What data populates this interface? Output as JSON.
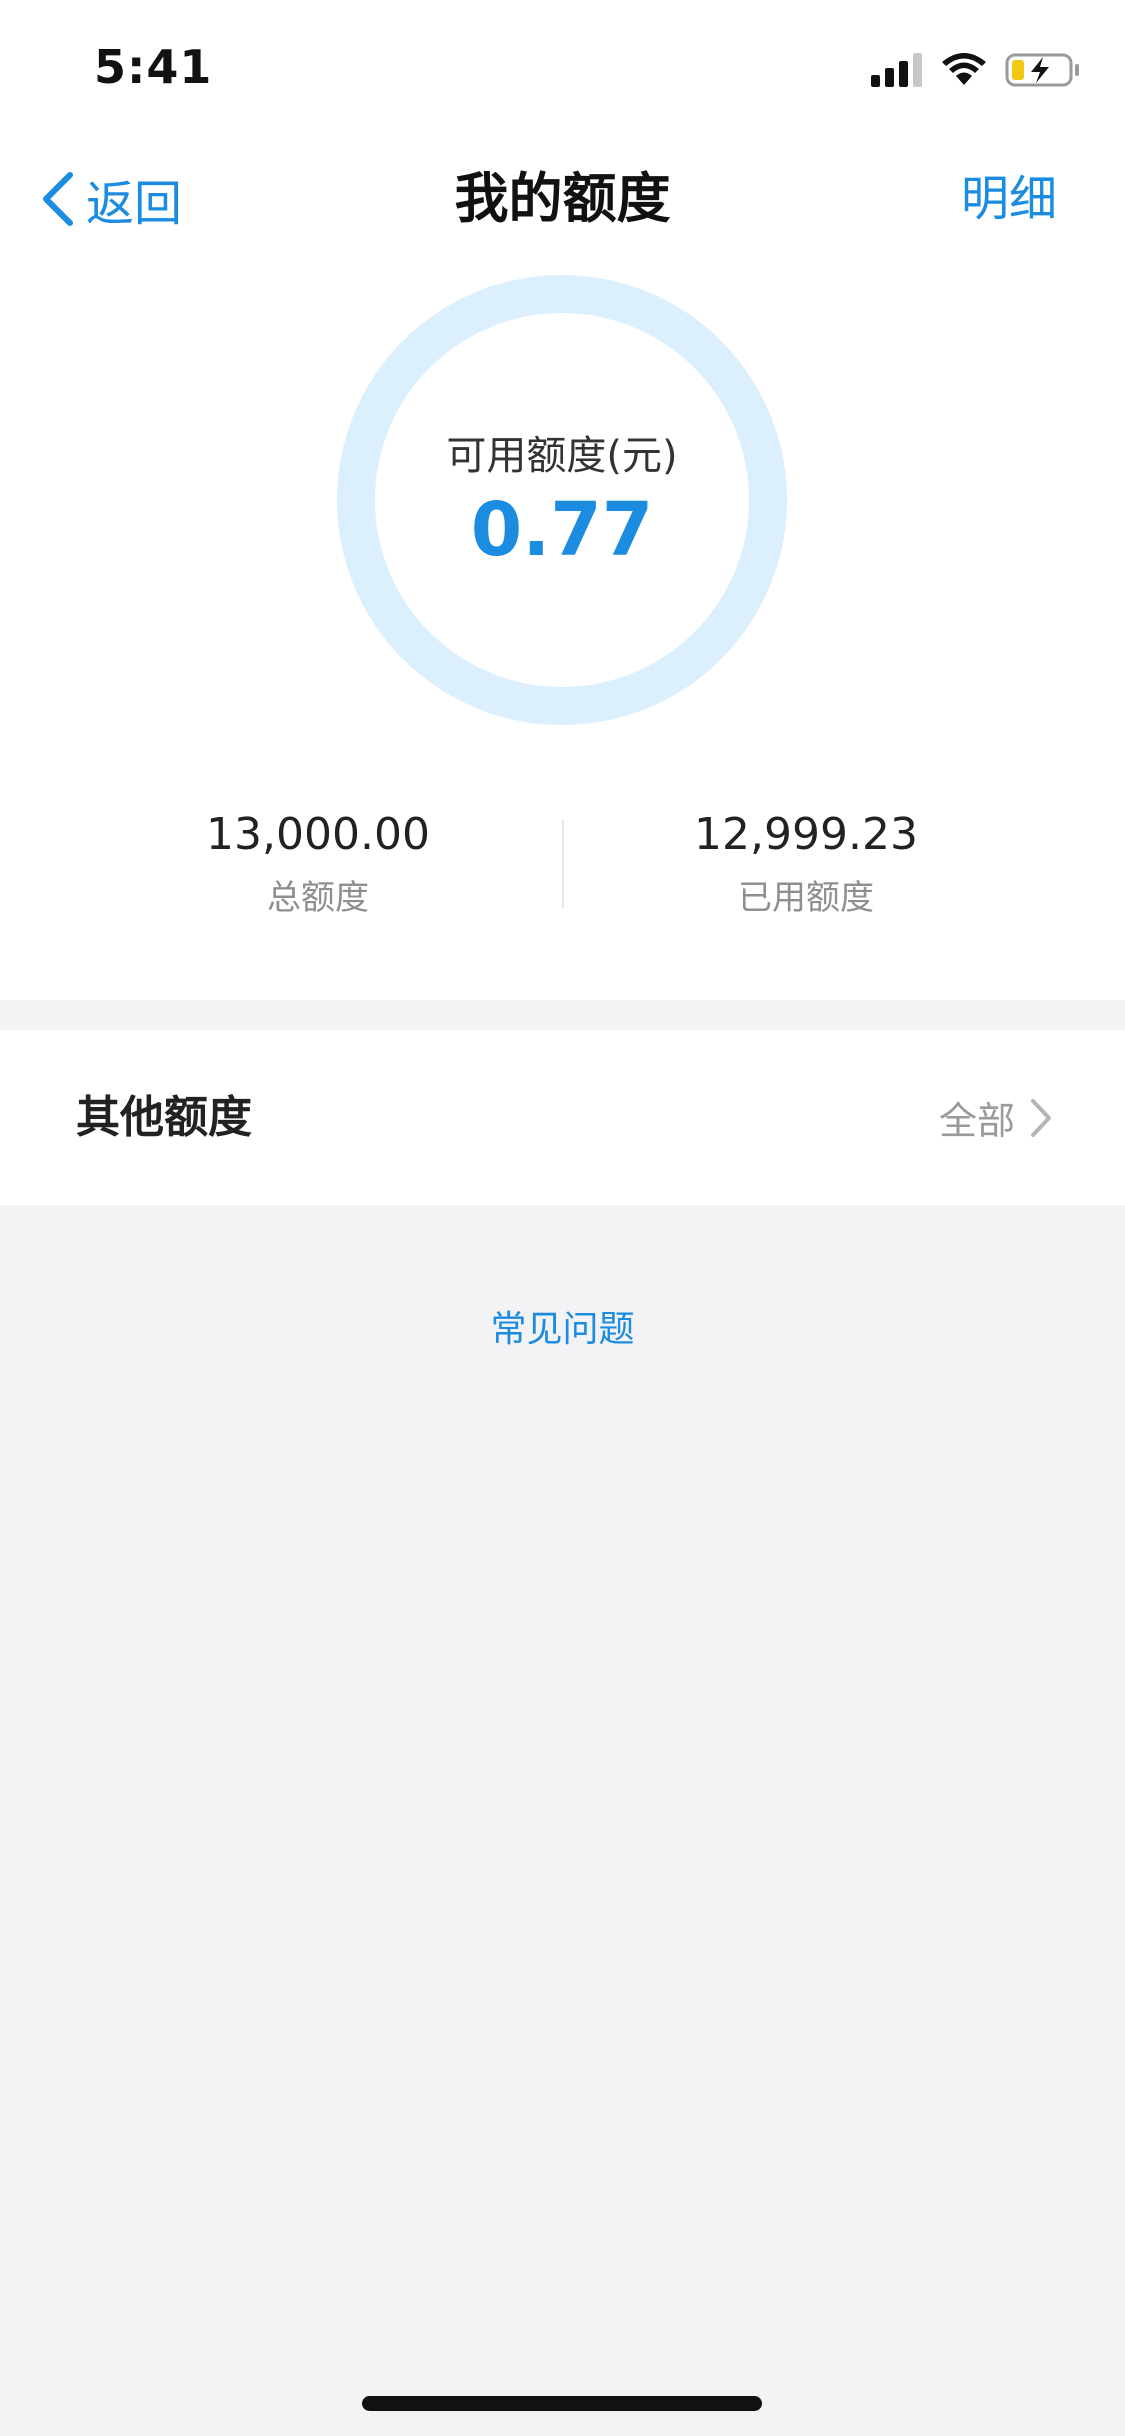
{
  "status_bar": {
    "time": "5:41"
  },
  "nav": {
    "back_label": "返回",
    "title": "我的额度",
    "detail_label": "明细"
  },
  "quota": {
    "available_label": "可用额度(元)",
    "available_value": "0.77",
    "total_value": "13,000.00",
    "total_label": "总额度",
    "used_value": "12,999.23",
    "used_label": "已用额度"
  },
  "other_quota": {
    "title": "其他额度",
    "all_label": "全部"
  },
  "faq": {
    "label": "常见问题"
  },
  "colors": {
    "accent": "#1b8ce0",
    "ring": "#dceffc",
    "background": "#f3f3f5"
  }
}
